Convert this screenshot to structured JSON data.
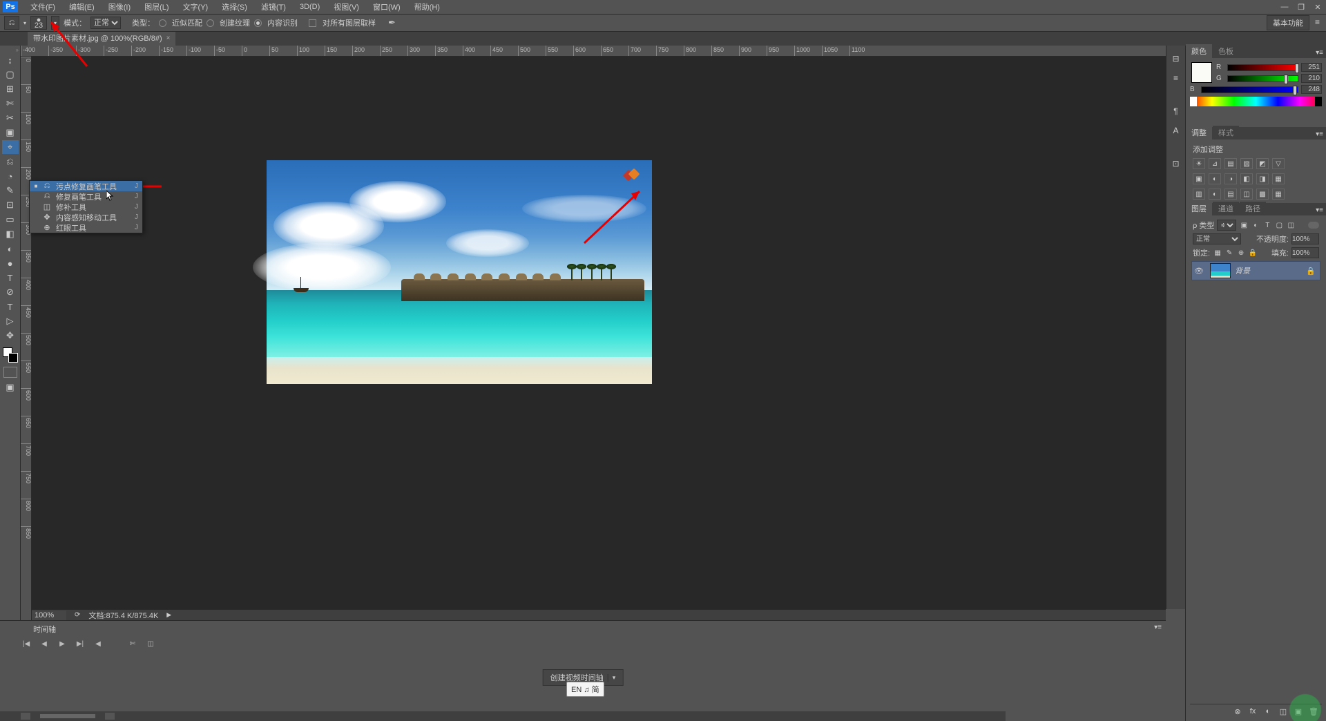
{
  "app": {
    "logo": "Ps"
  },
  "menubar": [
    "文件(F)",
    "编辑(E)",
    "图像(I)",
    "图层(L)",
    "文字(Y)",
    "选择(S)",
    "滤镜(T)",
    "3D(D)",
    "视图(V)",
    "窗口(W)",
    "帮助(H)"
  ],
  "window_controls": {
    "min": "—",
    "max": "❐",
    "close": "✕"
  },
  "optbar": {
    "brush_size": "23",
    "mode_label": "模式：",
    "mode_value": "正常",
    "type_label": "类型：",
    "radios": [
      {
        "label": "近似匹配",
        "sel": false
      },
      {
        "label": "创建纹理",
        "sel": false
      },
      {
        "label": "内容识别",
        "sel": true
      }
    ],
    "check_label": "对所有图层取样",
    "workspace": "基本功能"
  },
  "tab": {
    "title": "带水印图片素材.jpg @ 100%(RGB/8#)",
    "close": "×"
  },
  "ruler_h": [
    "-400",
    "-350",
    "-300",
    "-250",
    "-200",
    "-150",
    "-100",
    "-50",
    "0",
    "50",
    "100",
    "150",
    "200",
    "250",
    "300",
    "350",
    "400",
    "450",
    "500",
    "550",
    "600",
    "650",
    "700",
    "750",
    "800",
    "850",
    "900",
    "950",
    "1000",
    "1050",
    "1100"
  ],
  "ruler_v": [
    "0",
    "50",
    "100",
    "150",
    "200",
    "250",
    "300",
    "350",
    "400",
    "450",
    "500",
    "550",
    "600",
    "650",
    "700",
    "750",
    "800",
    "850"
  ],
  "toolbox_icons": [
    "↕",
    "▢",
    "⊞",
    "✄",
    "✂",
    "▣",
    "⌖",
    "⎌",
    "◔",
    "✎",
    "⊡",
    "▭",
    "◧",
    "◐",
    "●",
    "◌",
    "⊘",
    "T",
    "▷",
    "✥",
    "⊕",
    "⌕"
  ],
  "flyout": [
    {
      "label": "污点修复画笔工具",
      "key": "J",
      "sel": true
    },
    {
      "label": "修复画笔工具",
      "key": "J",
      "sel": false
    },
    {
      "label": "修补工具",
      "key": "J",
      "sel": false
    },
    {
      "label": "内容感知移动工具",
      "key": "J",
      "sel": false
    },
    {
      "label": "红眼工具",
      "key": "J",
      "sel": false
    }
  ],
  "status": {
    "zoom": "100%",
    "docinfo": "文档:875.4 K/875.4K"
  },
  "timeline": {
    "tab": "时间轴",
    "button": "创建视频时间轴",
    "ime": "EN ♫ 简"
  },
  "right_col": [
    "⊟",
    "≡",
    "⊞",
    "¶",
    "A",
    "⊡"
  ],
  "color_panel": {
    "tabs": [
      "颜色",
      "色板"
    ],
    "r": {
      "label": "R",
      "value": "251"
    },
    "g": {
      "label": "G",
      "value": "210"
    },
    "b": {
      "label": "B",
      "value": "248"
    }
  },
  "adjust_panel": {
    "tabs": [
      "调整",
      "样式"
    ],
    "title": "添加调整",
    "row1": [
      "☀",
      "⊿",
      "▤",
      "▨",
      "◩",
      "▽"
    ],
    "row2": [
      "▣",
      "◐",
      "◑",
      "◧",
      "◨",
      "▦"
    ],
    "row3": [
      "▥",
      "◐",
      "▤",
      "◫",
      "▩",
      "▦"
    ]
  },
  "layers_panel": {
    "tabs": [
      "图层",
      "通道",
      "路径"
    ],
    "kind_label": "ρ 类型",
    "kind_filter": "≑",
    "filter_icons": [
      "▣",
      "◐",
      "T",
      "▢",
      "◫"
    ],
    "blend": "正常",
    "opacity_label": "不透明度:",
    "opacity": "100%",
    "lock_label": "锁定:",
    "lock_icons": [
      "▦",
      "✎",
      "⊕",
      "🔒"
    ],
    "fill_label": "填充:",
    "fill": "100%",
    "layer": {
      "eye": "👁",
      "name": "背景",
      "lock": "🔒"
    },
    "bottom": [
      "⊗",
      "fx",
      "◐",
      "◫",
      "▣",
      "🗑"
    ]
  }
}
